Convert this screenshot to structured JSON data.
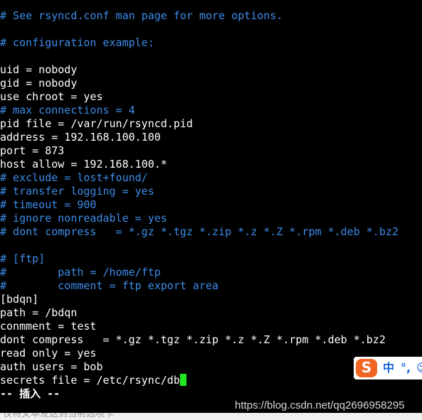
{
  "editor": {
    "lines": [
      {
        "text": "# See rsyncd.conf man page for more options.",
        "kind": "comment"
      },
      {
        "text": "",
        "kind": "normal"
      },
      {
        "text": "# configuration example:",
        "kind": "comment"
      },
      {
        "text": "",
        "kind": "normal"
      },
      {
        "text": "uid = nobody",
        "kind": "normal"
      },
      {
        "text": "gid = nobody",
        "kind": "normal"
      },
      {
        "text": "use chroot = yes",
        "kind": "normal"
      },
      {
        "text": "# max connections = 4",
        "kind": "comment"
      },
      {
        "text": "pid file = /var/run/rsyncd.pid",
        "kind": "normal"
      },
      {
        "text": "address = 192.168.100.100",
        "kind": "normal"
      },
      {
        "text": "port = 873",
        "kind": "normal"
      },
      {
        "text": "host allow = 192.168.100.*",
        "kind": "normal"
      },
      {
        "text": "# exclude = lost+found/",
        "kind": "comment"
      },
      {
        "text": "# transfer logging = yes",
        "kind": "comment"
      },
      {
        "text": "# timeout = 900",
        "kind": "comment"
      },
      {
        "text": "# ignore nonreadable = yes",
        "kind": "comment"
      },
      {
        "text": "# dont compress   = *.gz *.tgz *.zip *.z *.Z *.rpm *.deb *.bz2",
        "kind": "comment"
      },
      {
        "text": "",
        "kind": "normal"
      },
      {
        "text": "# [ftp]",
        "kind": "comment"
      },
      {
        "text": "#        path = /home/ftp",
        "kind": "comment"
      },
      {
        "text": "#        comment = ftp export area",
        "kind": "comment"
      },
      {
        "text": "[bdqn]",
        "kind": "normal"
      },
      {
        "text": "path = /bdqn",
        "kind": "normal"
      },
      {
        "text": "conmment = test",
        "kind": "normal"
      },
      {
        "text": "dont compress   = *.gz *.tgz *.zip *.z *.Z *.rpm *.deb *.bz2",
        "kind": "normal"
      },
      {
        "text": "read only = yes",
        "kind": "normal"
      },
      {
        "text": "auth users = bob",
        "kind": "normal"
      },
      {
        "text": "secrets file = /etc/rsync/db",
        "kind": "normal",
        "cursor": true
      }
    ],
    "status_line": "-- 插入 --",
    "cursor_color": "#22e622",
    "comment_color": "#3c8ce8",
    "text_color": "#ffffff",
    "background_color": "#000000"
  },
  "ime": {
    "logo": "S",
    "mode": "中",
    "punct": "°,",
    "extra": "☺",
    "logo_icon": "sogou-logo-icon",
    "brand_color": "#f26522"
  },
  "watermark": "https://blog.csdn.net/qq2696958295",
  "bottom_hint": "仅将文本发送到当前选项卡"
}
